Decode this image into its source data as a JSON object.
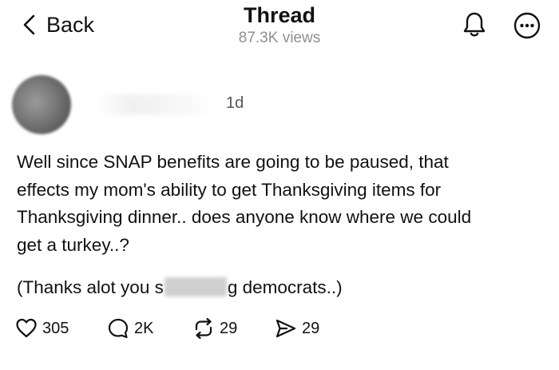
{
  "header": {
    "back_label": "Back",
    "title": "Thread",
    "views": "87.3K views"
  },
  "post": {
    "time": "1d",
    "lines": [
      "Well since SNAP benefits are going to be paused, that",
      "effects my mom's ability to get Thanksgiving items for",
      "Thanksgiving dinner.. does anyone know where we could",
      "get a turkey..?"
    ],
    "note_before": "(Thanks alot you s",
    "note_after": "g democrats..)"
  },
  "actions": {
    "likes": "305",
    "replies": "2K",
    "reposts": "29",
    "shares": "29"
  },
  "icons": {
    "back": "chevron-left-icon",
    "bell": "bell-icon",
    "more": "more-icon",
    "like": "heart-icon",
    "reply": "comment-icon",
    "repost": "repost-icon",
    "share": "send-icon"
  },
  "colors": {
    "text": "#111111",
    "muted": "#8e8e93",
    "background": "#ffffff"
  }
}
